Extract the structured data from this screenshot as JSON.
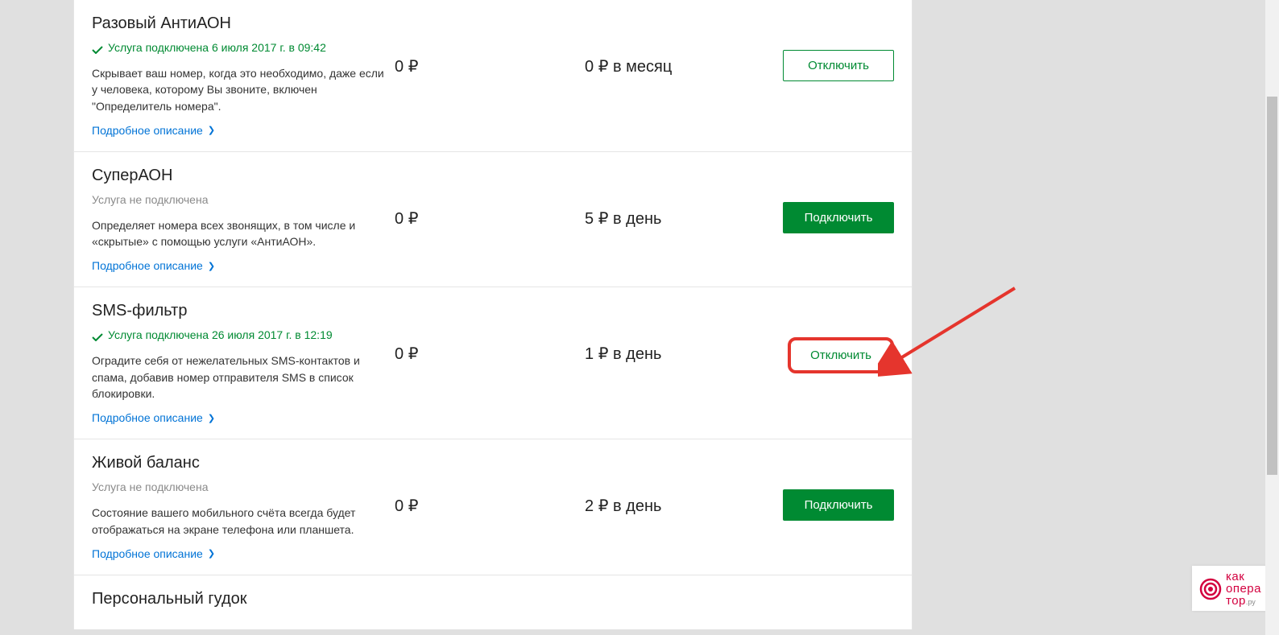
{
  "common": {
    "details_link": "Подробное описание",
    "disconnect_label": "Отключить",
    "connect_label": "Подключить",
    "ruble": "₽"
  },
  "services": [
    {
      "title": "Разовый АнтиАОН",
      "status_active": true,
      "status_text": "Услуга подключена 6 июля 2017 г. в 09:42",
      "description": "Скрывает ваш номер, когда это необходимо, даже если у человека, которому Вы звоните, включен \"Определитель номера\".",
      "price1": "0",
      "price2_value": "0",
      "price2_period": " в месяц",
      "action": "disconnect",
      "highlighted": false
    },
    {
      "title": "СуперАОН",
      "status_active": false,
      "status_text": "Услуга не подключена",
      "description": "Определяет номера всех звонящих, в том числе и «скрытые» с помощью услуги «АнтиАОН».",
      "price1": "0",
      "price2_value": "5",
      "price2_period": " в день",
      "action": "connect",
      "highlighted": false
    },
    {
      "title": "SMS-фильтр",
      "status_active": true,
      "status_text": "Услуга подключена 26 июля 2017 г. в 12:19",
      "description": "Оградите себя от нежелательных SMS-контактов и спама, добавив номер отправителя SMS в список блокировки.",
      "price1": "0",
      "price2_value": "1",
      "price2_period": " в день",
      "action": "disconnect",
      "highlighted": true
    },
    {
      "title": "Живой баланс",
      "status_active": false,
      "status_text": "Услуга не подключена",
      "description": "Состояние вашего мобильного счёта всегда будет отображаться на экране телефона или планшета.",
      "price1": "0",
      "price2_value": "2",
      "price2_period": " в день",
      "action": "connect",
      "highlighted": false
    },
    {
      "title": "Персональный гудок",
      "status_active": null,
      "status_text": "",
      "description": "",
      "price1": "",
      "price2_value": "",
      "price2_period": "",
      "action": "",
      "highlighted": false
    }
  ],
  "watermark": {
    "line1": "как",
    "line2": "опера",
    "line3": "тор",
    "suffix": ".ру"
  }
}
